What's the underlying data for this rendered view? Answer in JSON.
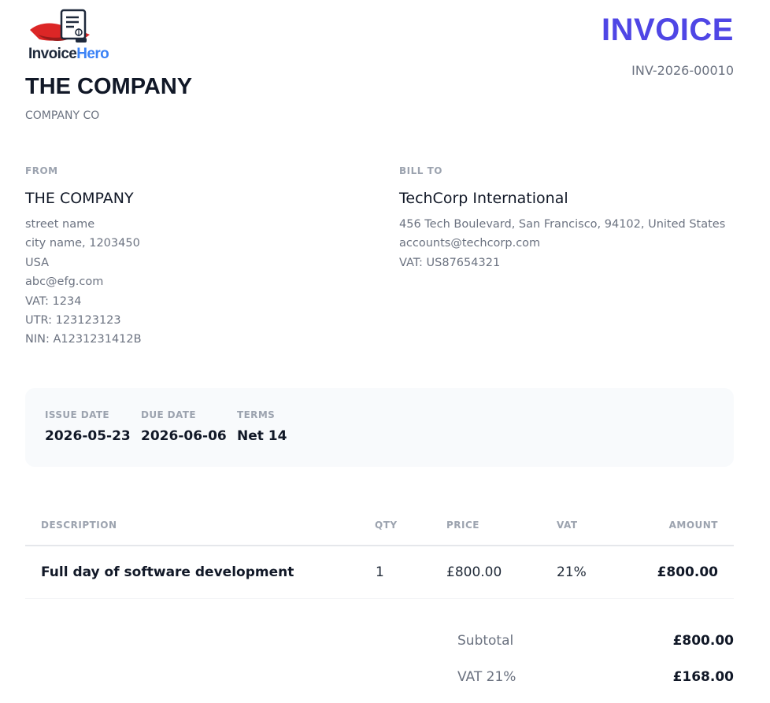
{
  "brand": {
    "logo_text_1": "Invoice",
    "logo_text_2": "Hero"
  },
  "invoice": {
    "title": "INVOICE",
    "number": "INV-2026-00010"
  },
  "company": {
    "name": "THE COMPANY",
    "subtitle": "COMPANY CO"
  },
  "from": {
    "label": "FROM",
    "name": "THE COMPANY",
    "lines": [
      "street name",
      "city name, 1203450",
      "USA",
      "abc@efg.com",
      "VAT: 1234",
      "UTR: 123123123",
      "NIN: A1231231412B"
    ]
  },
  "bill_to": {
    "label": "BILL TO",
    "name": "TechCorp International",
    "lines": [
      "456 Tech Boulevard, San Francisco, 94102, United States",
      "accounts@techcorp.com",
      "VAT: US87654321"
    ]
  },
  "meta": {
    "issue_date_label": "ISSUE DATE",
    "issue_date": "2026-05-23",
    "due_date_label": "DUE DATE",
    "due_date": "2026-06-06",
    "terms_label": "TERMS",
    "terms": "Net 14"
  },
  "table": {
    "headers": {
      "description": "DESCRIPTION",
      "qty": "QTY",
      "price": "PRICE",
      "vat": "VAT",
      "amount": "AMOUNT"
    },
    "rows": [
      {
        "description": "Full day of software development",
        "qty": "1",
        "price": "£800.00",
        "vat": "21%",
        "amount": "£800.00"
      }
    ]
  },
  "totals": {
    "subtotal_label": "Subtotal",
    "subtotal": "£800.00",
    "vat_label": "VAT 21%",
    "vat": "£168.00"
  },
  "colors": {
    "accent": "#4f46e5",
    "logo_blue": "#3b82f6",
    "logo_red": "#dc2626"
  },
  "icons": {
    "logo": "invoice-document-with-cape-icon"
  }
}
